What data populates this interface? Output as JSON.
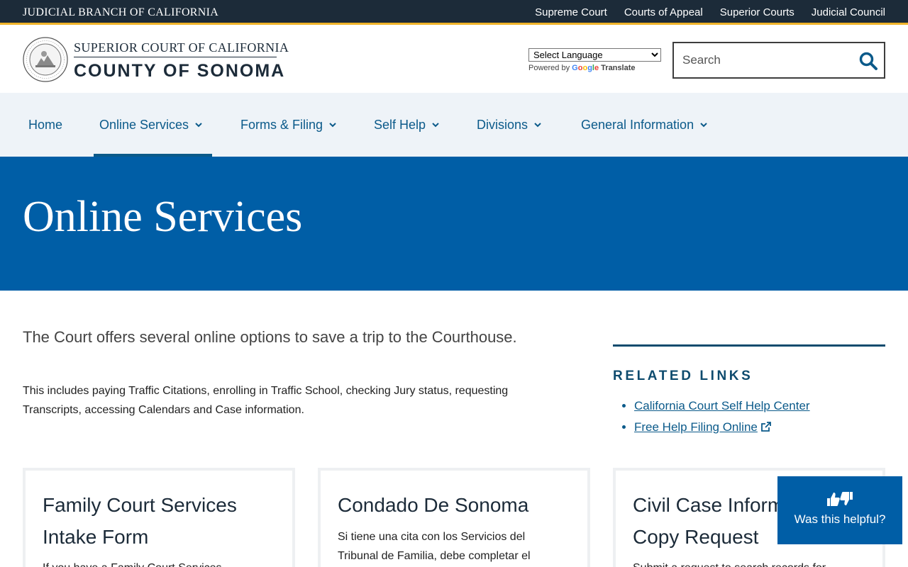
{
  "utility": {
    "title": "JUDICIAL BRANCH OF CALIFORNIA",
    "links": [
      "Supreme Court",
      "Courts of Appeal",
      "Superior Courts",
      "Judicial Council"
    ]
  },
  "header": {
    "brand_top": "SUPERIOR COURT OF CALIFORNIA",
    "brand_bottom": "COUNTY OF SONOMA",
    "language_select": "Select Language",
    "powered_by": "Powered by",
    "google": "Google",
    "translate": "Translate",
    "search_placeholder": "Search"
  },
  "nav": {
    "items": [
      {
        "label": "Home"
      },
      {
        "label": "Online Services"
      },
      {
        "label": "Forms & Filing"
      },
      {
        "label": "Self Help"
      },
      {
        "label": "Divisions"
      },
      {
        "label": "General Information"
      }
    ],
    "active": "Online Services"
  },
  "hero": {
    "title": "Online Services"
  },
  "main": {
    "lead": "The Court offers several online options to save a trip to the Courthouse.",
    "paragraph": "This includes paying Traffic Citations, enrolling in Traffic School, checking Jury status, requesting Transcripts, accessing Calendars and Case information."
  },
  "related": {
    "heading": "RELATED LINKS",
    "links": [
      "California Court Self Help Center",
      "Free Help Filing Online"
    ]
  },
  "cards": [
    {
      "title": "Family Court Services Intake Form",
      "text": "If you have a Family Court Services"
    },
    {
      "title": "Condado De Sonoma",
      "text": "Si tiene una cita con los Servicios del Tribunal de Familia, debe completar el"
    },
    {
      "title": "Civil Case Information Copy Request",
      "text": "Submit a request to search records for"
    }
  ],
  "helpful": {
    "label": "Was this helpful?"
  },
  "colors": {
    "utility_bg": "#1c2b39",
    "accent_gold": "#f0b429",
    "nav_bg": "#eef3f8",
    "link_blue": "#0b5a8a",
    "hero_bg": "#005ea6"
  }
}
